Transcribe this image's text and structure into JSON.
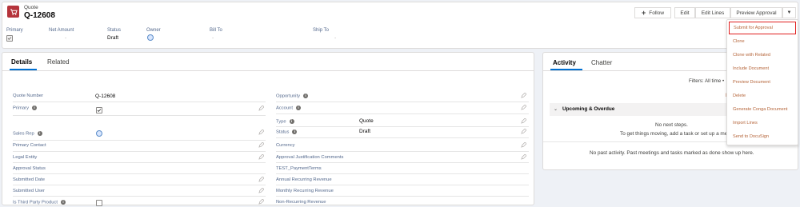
{
  "record": {
    "object_label": "Quote",
    "name": "Q-12608"
  },
  "actions": {
    "follow": "Follow",
    "edit": "Edit",
    "edit_lines": "Edit Lines",
    "preview_approval": "Preview Approval"
  },
  "highlights": {
    "primary_label": "Primary",
    "net_amount_label": "Net Amount",
    "net_amount_value": "-",
    "status_label": "Status",
    "status_value": "Draft",
    "owner_label": "Owner",
    "bill_to_label": "Bill To",
    "bill_to_value": "-",
    "ship_to_label": "Ship To",
    "ship_to_value": "-"
  },
  "menu": {
    "items": [
      "Submit for Approval",
      "Clone",
      "Clone with Related",
      "Include Document",
      "Preview Document",
      "Delete",
      "Generate Conga Document",
      "Import Lines",
      "Send to DocuSign"
    ]
  },
  "details": {
    "tabs": [
      "Details",
      "Related"
    ],
    "left_fields": {
      "quote_number": {
        "label": "Quote Number",
        "value": "Q-12608"
      },
      "primary": {
        "label": "Primary"
      },
      "sales_rep": {
        "label": "Sales Rep"
      },
      "primary_contact": {
        "label": "Primary Contact"
      },
      "legal_entity": {
        "label": "Legal Entity"
      },
      "approval_status": {
        "label": "Approval Status"
      },
      "submitted_date": {
        "label": "Submitted Date"
      },
      "submitted_user": {
        "label": "Submitted User"
      },
      "is_third_party": {
        "label": "Is Third Party Product"
      }
    },
    "right_fields": {
      "opportunity": {
        "label": "Opportunity"
      },
      "account": {
        "label": "Account"
      },
      "type": {
        "label": "Type",
        "value": "Quote"
      },
      "status": {
        "label": "Status",
        "value": "Draft"
      },
      "currency": {
        "label": "Currency"
      },
      "approval_justification": {
        "label": "Approval Justification Comments"
      },
      "test_paymentterms": {
        "label": "TEST_PaymentTerms"
      },
      "annual_recurring": {
        "label": "Annual Recurring Revenue"
      },
      "monthly_recurring": {
        "label": "Monthly Recurring Revenue"
      },
      "non_recurring": {
        "label": "Non-Recurring Revenue"
      }
    }
  },
  "activity": {
    "tabs": [
      "Activity",
      "Chatter"
    ],
    "filters": "Filters: All time •",
    "refresh_label": "R",
    "section_title": "Upcoming & Overdue",
    "no_next_steps": "No next steps.",
    "get_moving": "To get things moving, add a task or set up a meeting.",
    "no_past": "No past activity. Past meetings and tasks marked as done show up here."
  },
  "colors": {
    "brand": "#0070d2",
    "icon_bg": "#b5343b",
    "menu_text": "#b5653a",
    "highlight_border": "#e01e1e"
  }
}
